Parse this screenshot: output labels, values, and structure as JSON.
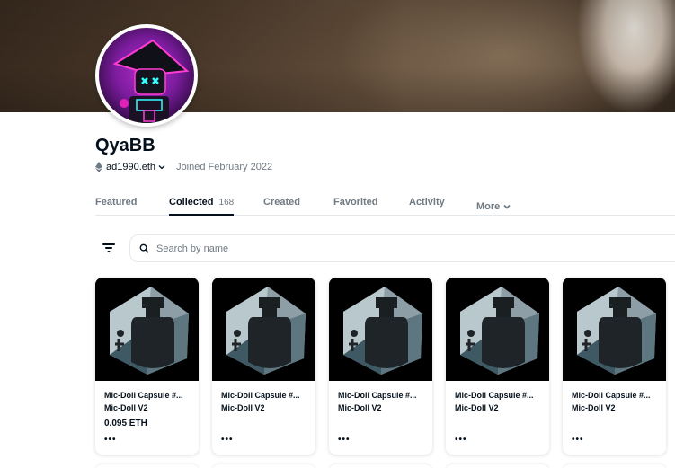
{
  "profile": {
    "name": "QyaBB",
    "address": "ad1990.eth",
    "joined": "Joined February 2022"
  },
  "tabs": [
    {
      "label": "Featured"
    },
    {
      "label": "Collected",
      "count": "168"
    },
    {
      "label": "Created"
    },
    {
      "label": "Favorited"
    },
    {
      "label": "Activity"
    },
    {
      "label": "More"
    }
  ],
  "search": {
    "placeholder": "Search by name"
  },
  "cards": [
    {
      "title": "Mic-Doll Capsule #...",
      "collection": "Mic-Doll V2",
      "price": "0.095 ETH",
      "menu": "•••"
    },
    {
      "title": "Mic-Doll Capsule #...",
      "collection": "Mic-Doll V2",
      "price": "",
      "menu": "•••"
    },
    {
      "title": "Mic-Doll Capsule #...",
      "collection": "Mic-Doll V2",
      "price": "",
      "menu": "•••"
    },
    {
      "title": "Mic-Doll Capsule #...",
      "collection": "Mic-Doll V2",
      "price": "",
      "menu": "•••"
    },
    {
      "title": "Mic-Doll Capsule #...",
      "collection": "Mic-Doll V2",
      "price": "",
      "menu": "•••"
    }
  ],
  "icons": {
    "avatar": "neon-robot-avatar",
    "chain": "ethereum-icon",
    "filter": "filter-icon",
    "search": "search-icon"
  },
  "colors": {
    "text": "#04111d",
    "muted": "#707a83",
    "border": "#e5e8eb"
  }
}
